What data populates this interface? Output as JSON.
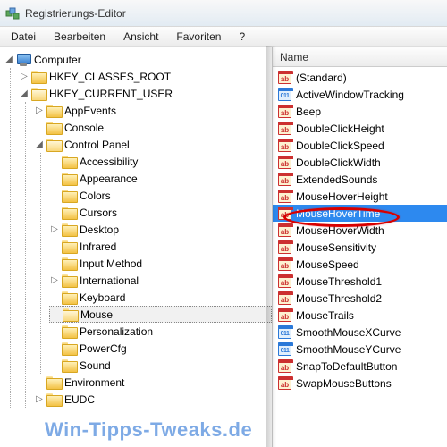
{
  "window": {
    "title": "Registrierungs-Editor"
  },
  "menu": {
    "file": "Datei",
    "edit": "Bearbeiten",
    "view": "Ansicht",
    "favorites": "Favoriten",
    "help": "?"
  },
  "tree": {
    "root": "Computer",
    "hkcr": "HKEY_CLASSES_ROOT",
    "hkcu": "HKEY_CURRENT_USER",
    "appevents": "AppEvents",
    "console": "Console",
    "controlpanel": "Control Panel",
    "cp_items": [
      "Accessibility",
      "Appearance",
      "Colors",
      "Cursors",
      "Desktop",
      "Infrared",
      "Input Method",
      "International",
      "Keyboard",
      "Mouse",
      "Personalization",
      "PowerCfg",
      "Sound"
    ],
    "environment": "Environment",
    "eudc": "EUDC"
  },
  "list": {
    "header": {
      "name": "Name"
    },
    "items": [
      {
        "type": "str",
        "label": "(Standard)"
      },
      {
        "type": "bin",
        "label": "ActiveWindowTracking"
      },
      {
        "type": "str",
        "label": "Beep"
      },
      {
        "type": "str",
        "label": "DoubleClickHeight"
      },
      {
        "type": "str",
        "label": "DoubleClickSpeed"
      },
      {
        "type": "str",
        "label": "DoubleClickWidth"
      },
      {
        "type": "str",
        "label": "ExtendedSounds"
      },
      {
        "type": "str",
        "label": "MouseHoverHeight"
      },
      {
        "type": "str",
        "label": "MouseHoverTime",
        "hl": true
      },
      {
        "type": "str",
        "label": "MouseHoverWidth"
      },
      {
        "type": "str",
        "label": "MouseSensitivity"
      },
      {
        "type": "str",
        "label": "MouseSpeed"
      },
      {
        "type": "str",
        "label": "MouseThreshold1"
      },
      {
        "type": "str",
        "label": "MouseThreshold2"
      },
      {
        "type": "str",
        "label": "MouseTrails"
      },
      {
        "type": "bin",
        "label": "SmoothMouseXCurve"
      },
      {
        "type": "bin",
        "label": "SmoothMouseYCurve"
      },
      {
        "type": "str",
        "label": "SnapToDefaultButton"
      },
      {
        "type": "str",
        "label": "SwapMouseButtons"
      }
    ]
  },
  "watermark": "Win-Tipps-Tweaks.de"
}
